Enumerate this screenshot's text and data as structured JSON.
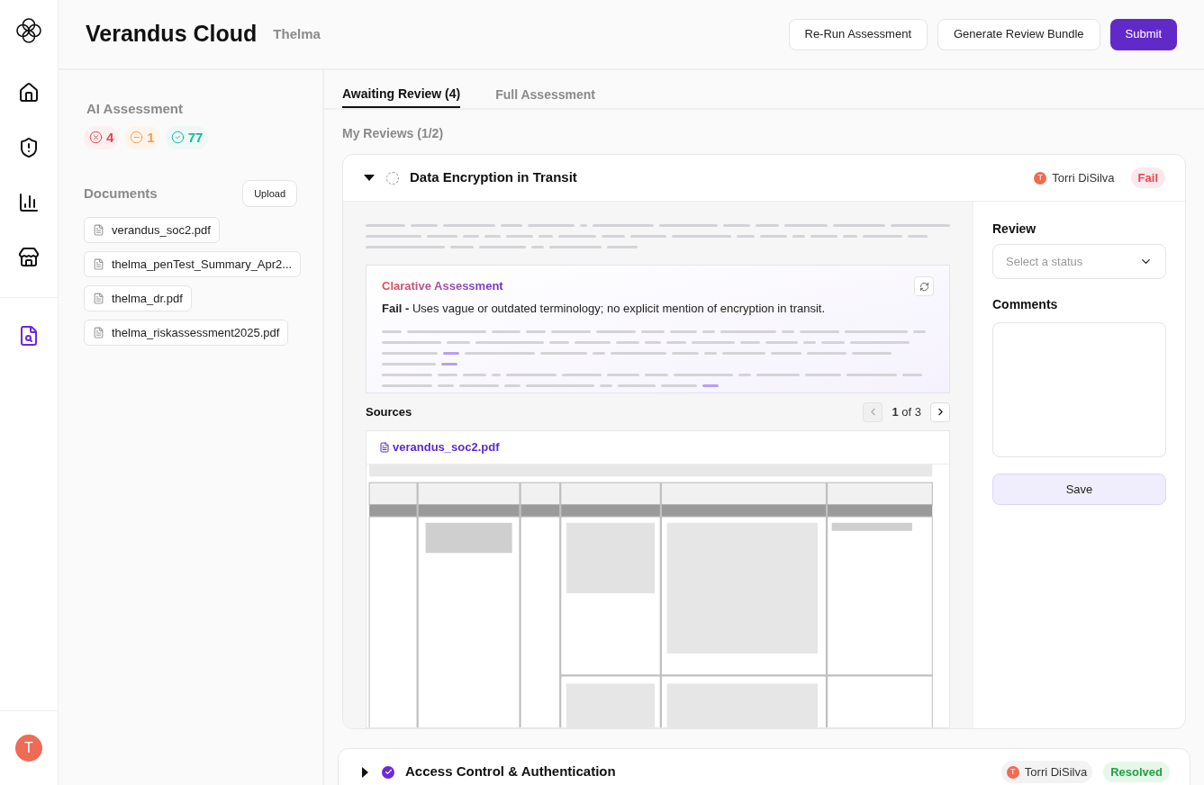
{
  "app": {
    "title": "Verandus Cloud",
    "subtitle": "Thelma"
  },
  "header_actions": [
    {
      "label": "Re-Run Assessment",
      "kind": "secondary"
    },
    {
      "label": "Generate Review Bundle",
      "kind": "secondary"
    },
    {
      "label": "Submit",
      "kind": "primary"
    }
  ],
  "nav": [
    {
      "selected": false
    },
    {
      "selected": false
    },
    {
      "selected": false
    },
    {
      "selected": false
    },
    {
      "selected": true
    }
  ],
  "user": {
    "initial": "T"
  },
  "ai_assessment": {
    "title": "AI Assessment",
    "counts": [
      {
        "kind": "fail",
        "value": "4"
      },
      {
        "kind": "partial",
        "value": "1"
      },
      {
        "kind": "pass",
        "value": "77"
      }
    ]
  },
  "documents": {
    "title": "Documents",
    "upload": "Upload",
    "files": [
      "verandus_soc2.pdf",
      "thelma_penTest_Summary_Apr2...",
      "thelma_dr.pdf",
      "thelma_riskassessment2025.pdf"
    ]
  },
  "tabs": [
    {
      "label": "Awaiting Review (4)",
      "selected": true
    },
    {
      "label": "Full Assessment",
      "selected": false
    }
  ],
  "section_title": "My Reviews (1/2)",
  "reviews": [
    {
      "title": "Data Encryption in Transit",
      "expanded": true,
      "done": false,
      "reviewer": {
        "initial": "T",
        "name": "Torri DiSilva"
      },
      "result": {
        "label": "Fail",
        "kind": "fail"
      },
      "assessment": {
        "heading": "Clarative Assessment",
        "text": "**Fail -** Uses vague or outdated terminology; no explicit mention of encryption in transit."
      },
      "sources": {
        "title": "Sources",
        "page": "**1** of 3",
        "prev_disabled": true,
        "next_disabled": false,
        "file": "verandus_soc2.pdf"
      },
      "form": {
        "review_label": "Review",
        "placeholder": "Select a status",
        "comments_label": "Comments",
        "save": "Save"
      }
    },
    {
      "title": "Access Control & Authentication",
      "expanded": false,
      "done": true,
      "reviewer": {
        "initial": "T",
        "name": "Torri DiSilva"
      },
      "result": {
        "label": "Resolved",
        "kind": "pass"
      }
    }
  ]
}
